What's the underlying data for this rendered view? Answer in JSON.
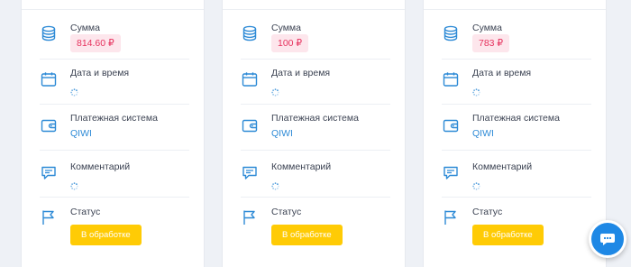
{
  "labels": {
    "amount": "Сумма",
    "datetime": "Дата и время",
    "payment_system": "Платежная система",
    "comment": "Комментарий",
    "status": "Статус"
  },
  "colors": {
    "accent": "#2d8ad6",
    "amount_text": "#e6325e",
    "amount_bg": "#fde6ec",
    "status_bg": "#ffcb05",
    "chat_button": "#1e88e5"
  },
  "cards": [
    {
      "amount": "814.60 ₽",
      "payment_system": "QIWI",
      "status": "В обработке"
    },
    {
      "amount": "100 ₽",
      "payment_system": "QIWI",
      "status": "В обработке"
    },
    {
      "amount": "783 ₽",
      "payment_system": "QIWI",
      "status": "В обработке"
    }
  ],
  "chat": {
    "icon": "chat-bubble-icon"
  }
}
